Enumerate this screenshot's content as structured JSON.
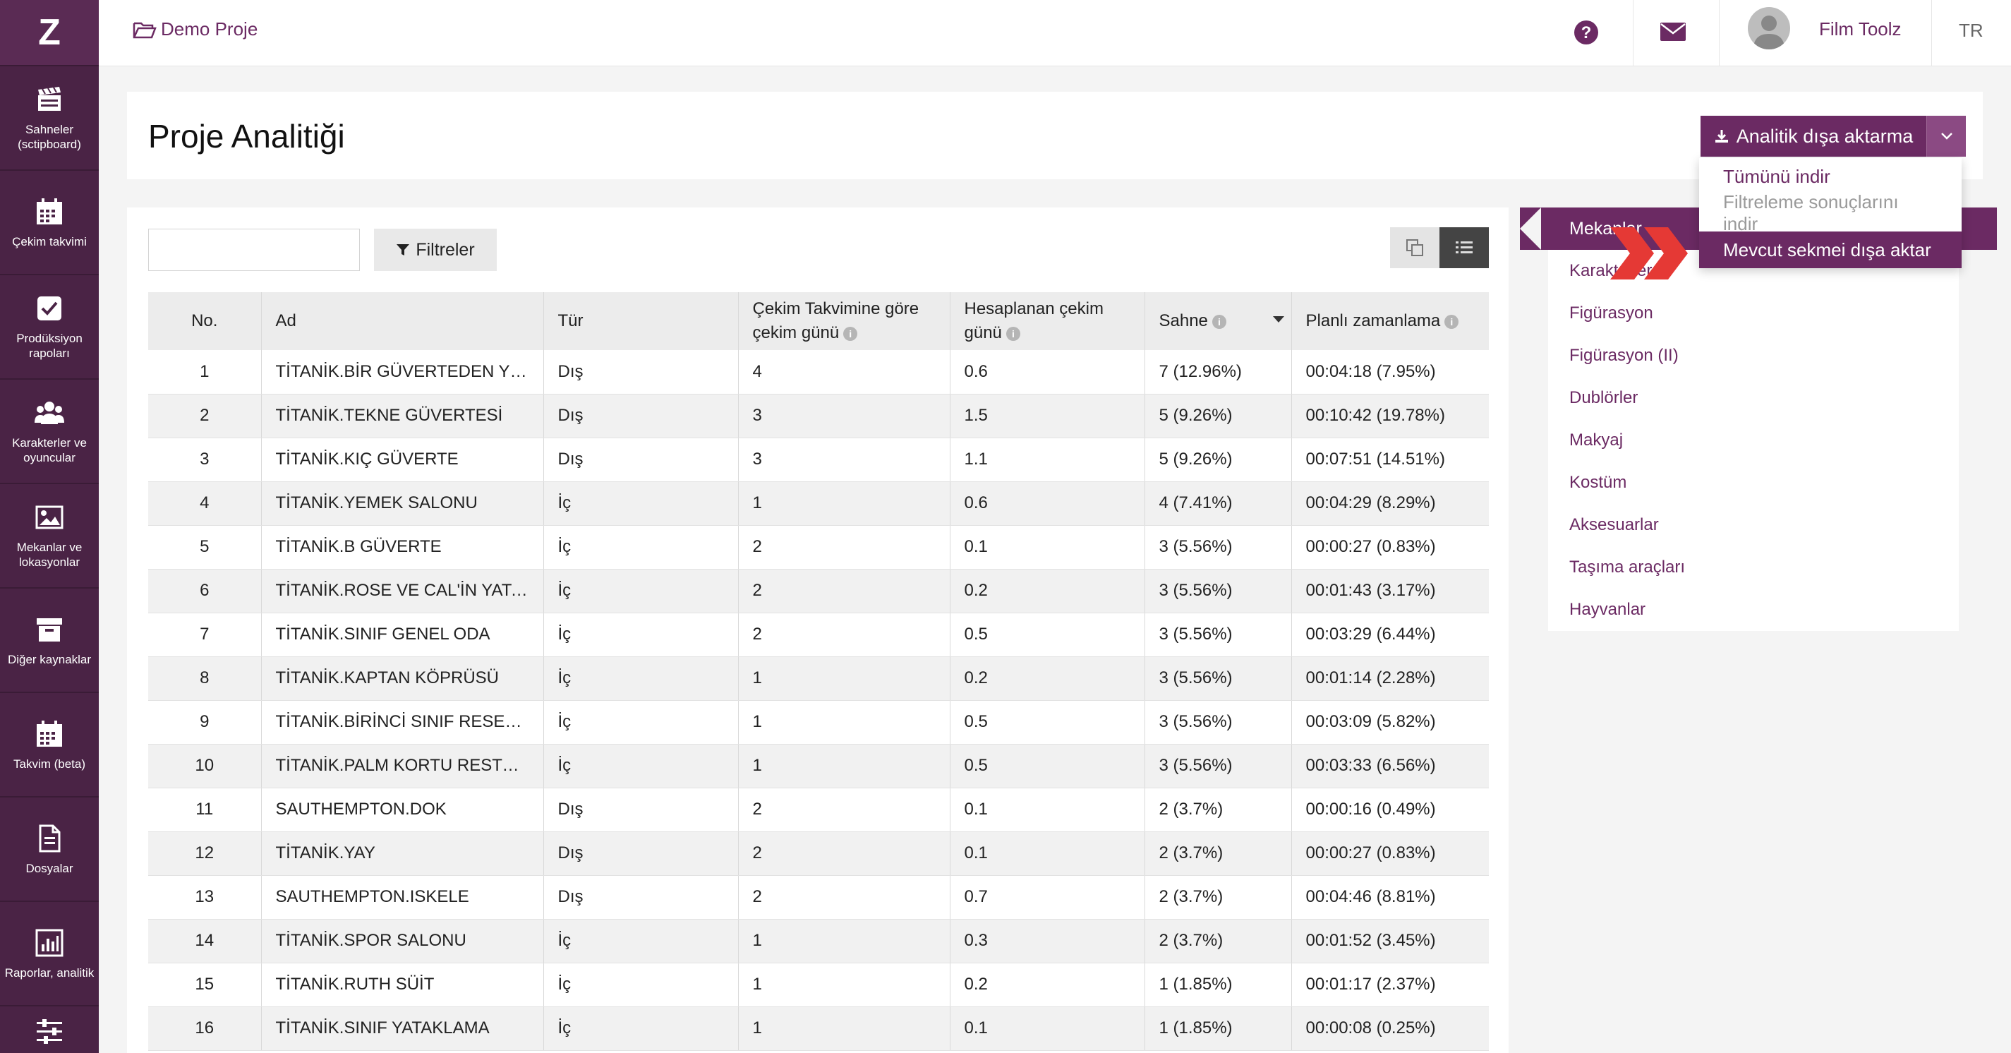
{
  "sidebar": {
    "logo": "Z",
    "items": [
      {
        "label": "Sahneler (sctipboard)",
        "icon": "clapperboard-icon"
      },
      {
        "label": "Çekim takvimi",
        "icon": "calendar-icon"
      },
      {
        "label": "Prodüksiyon rapoları",
        "icon": "checkbox-icon"
      },
      {
        "label": "Karakterler ve oyuncular",
        "icon": "people-icon"
      },
      {
        "label": "Mekanlar ve lokasyonlar",
        "icon": "image-icon"
      },
      {
        "label": "Diğer kaynaklar",
        "icon": "archive-icon"
      },
      {
        "label": "Takvim (beta)",
        "icon": "calendar-icon"
      },
      {
        "label": "Dosyalar",
        "icon": "file-icon"
      },
      {
        "label": "Raporlar, analitik",
        "icon": "bar-chart-icon"
      },
      {
        "label": "",
        "icon": "sliders-icon"
      }
    ]
  },
  "topbar": {
    "breadcrumb": "Demo Proje",
    "username": "Film Toolz",
    "language": "TR"
  },
  "header": {
    "title": "Proje Analitiği",
    "export_label": "Analitik dışa aktarma",
    "export_menu": [
      "Tümünü indir",
      "Filtreleme sonuçlarını indir",
      "Mevcut sekmei dışa aktar"
    ]
  },
  "toolbar": {
    "search_placeholder": "",
    "filter_label": "Filtreler"
  },
  "table": {
    "columns": [
      "No.",
      "Ad",
      "Tür",
      "Çekim Takvimine göre çekim günü",
      "Hesaplanan çekim günü",
      "Sahne",
      "Planlı zamanlama"
    ],
    "rows": [
      [
        "1",
        "TİTANİK.BİR GÜVERTEDEN YÜRÜYÜŞ",
        "Dış",
        "4",
        "0.6",
        "7 (12.96%)",
        "00:04:18 (7.95%)"
      ],
      [
        "2",
        "TİTANİK.TEKNE GÜVERTESİ",
        "Dış",
        "3",
        "1.5",
        "5 (9.26%)",
        "00:10:42 (19.78%)"
      ],
      [
        "3",
        "TİTANİK.KIÇ GÜVERTE",
        "Dış",
        "3",
        "1.1",
        "5 (9.26%)",
        "00:07:51 (14.51%)"
      ],
      [
        "4",
        "TİTANİK.YEMEK SALONU",
        "İç",
        "1",
        "0.6",
        "4 (7.41%)",
        "00:04:29 (8.29%)"
      ],
      [
        "5",
        "TİTANİK.B GÜVERTE",
        "İç",
        "2",
        "0.1",
        "3 (5.56%)",
        "00:00:27 (0.83%)"
      ],
      [
        "6",
        "TİTANİK.ROSE VE CAL'İN YATAK ODASI",
        "İç",
        "2",
        "0.2",
        "3 (5.56%)",
        "00:01:43 (3.17%)"
      ],
      [
        "7",
        "TİTANİK.SINIF GENEL ODA",
        "İç",
        "2",
        "0.5",
        "3 (5.56%)",
        "00:03:29 (6.44%)"
      ],
      [
        "8",
        "TİTANİK.KAPTAN KÖPRÜSÜ",
        "İç",
        "1",
        "0.2",
        "3 (5.56%)",
        "00:01:14 (2.28%)"
      ],
      [
        "9",
        "TİTANİK.BİRİNCİ SINIF RESEPSİYON",
        "İç",
        "1",
        "0.5",
        "3 (5.56%)",
        "00:03:09 (5.82%)"
      ],
      [
        "10",
        "TİTANİK.PALM KORTU RESTORANI",
        "İç",
        "1",
        "0.5",
        "3 (5.56%)",
        "00:03:33 (6.56%)"
      ],
      [
        "11",
        "SAUTHEMPTON.DOK",
        "Dış",
        "2",
        "0.1",
        "2 (3.7%)",
        "00:00:16 (0.49%)"
      ],
      [
        "12",
        "TİTANİK.YAY",
        "Dış",
        "2",
        "0.1",
        "2 (3.7%)",
        "00:00:27 (0.83%)"
      ],
      [
        "13",
        "SAUTHEMPTON.ISKELE",
        "Dış",
        "2",
        "0.7",
        "2 (3.7%)",
        "00:04:46 (8.81%)"
      ],
      [
        "14",
        "TİTANİK.SPOR SALONU",
        "İç",
        "1",
        "0.3",
        "2 (3.7%)",
        "00:01:52 (3.45%)"
      ],
      [
        "15",
        "TİTANİK.RUTH SÜİT",
        "İç",
        "1",
        "0.2",
        "1 (1.85%)",
        "00:01:17 (2.37%)"
      ],
      [
        "16",
        "TİTANİK.SINIF YATAKLAMA",
        "İç",
        "1",
        "0.1",
        "1 (1.85%)",
        "00:00:08 (0.25%)"
      ]
    ]
  },
  "tabs": {
    "active": "Mekanlar",
    "items": [
      "Karakterler",
      "Figürasyon",
      "Figürasyon (II)",
      "Dublörler",
      "Makyaj",
      "Kostüm",
      "Aksesuarlar",
      "Taşıma araçları",
      "Hayvanlar"
    ]
  },
  "colors": {
    "brand": "#6b2a63",
    "sidebar": "#4a2345",
    "highlight": "#e53935"
  }
}
